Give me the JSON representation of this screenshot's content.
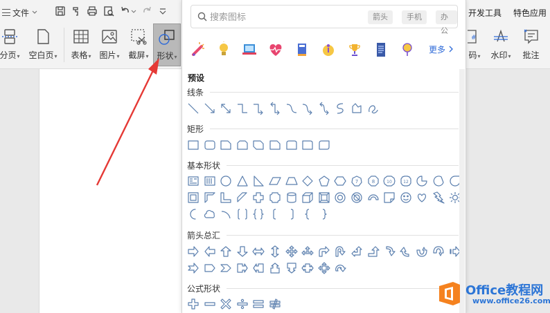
{
  "toolbar": {
    "file_menu": "文件",
    "tabs_right": [
      "开发工具",
      "特色应用"
    ]
  },
  "ribbon": {
    "buttons": [
      "分页",
      "空白页",
      "表格",
      "图片",
      "截屏",
      "形状",
      "码",
      "水印",
      "批注"
    ]
  },
  "shapes_panel": {
    "search_placeholder": "搜索图标",
    "tags": [
      "箭头",
      "手机",
      "办公"
    ],
    "more": "更多",
    "sections": {
      "preset": "预设",
      "lines": "线条",
      "rect": "矩形",
      "basic": "基本形状",
      "arrows": "箭头总汇",
      "formula": "公式形状"
    }
  },
  "watermark": {
    "brand": "Office教程网",
    "url": "www.office26.com"
  },
  "colors": {
    "accent": "#2f6bd8",
    "shape_stroke": "#5b7fae",
    "arrow": "#e53935",
    "watermark_orange": "#f5821f"
  }
}
